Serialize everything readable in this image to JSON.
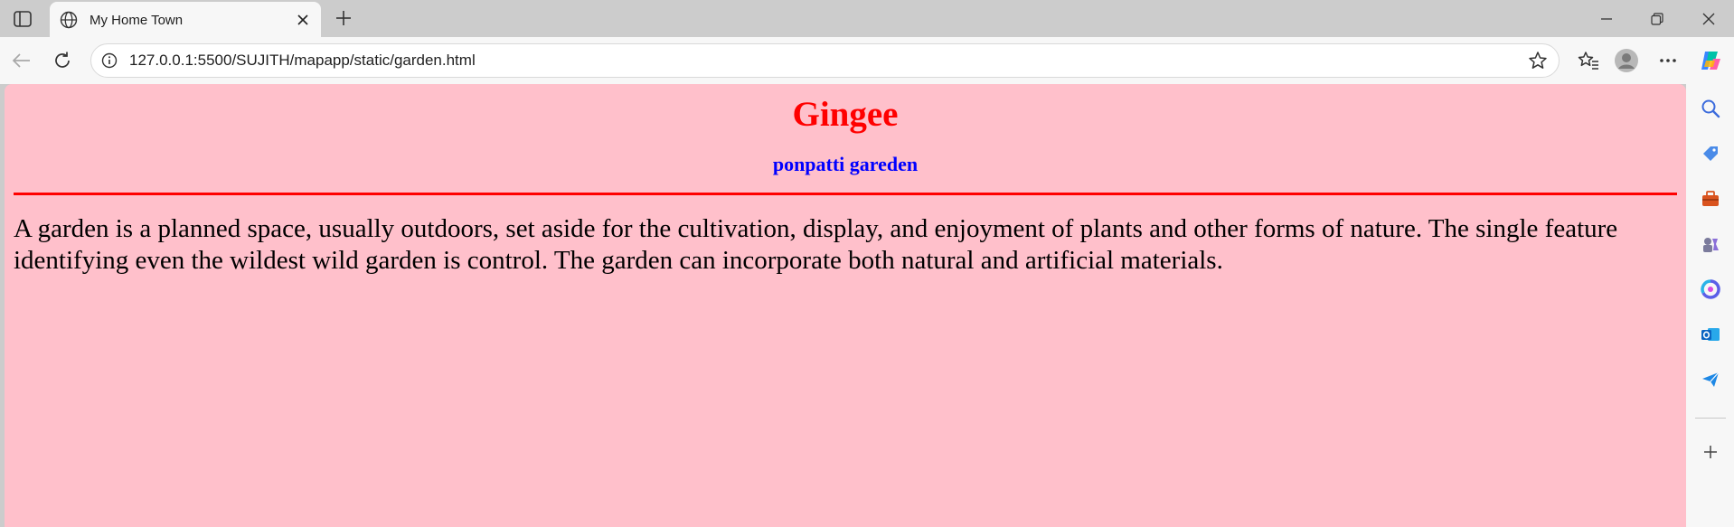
{
  "browser": {
    "tab": {
      "title": "My Home Town",
      "close_label": "×"
    },
    "new_tab_label": "+",
    "address": {
      "url": "127.0.0.1:5500/SUJITH/mapapp/static/garden.html"
    }
  },
  "page": {
    "heading": "Gingee",
    "subheading": "ponpatti gareden",
    "paragraph": "A garden is a planned space, usually outdoors, set aside for the cultivation, display, and enjoyment of plants and other forms of nature. The single feature identifying even the wildest wild garden is control. The garden can incorporate both natural and artificial materials."
  },
  "colors": {
    "page_background": "#ffc0cb",
    "heading": "#ff0000",
    "subheading": "#0000ff",
    "rule": "#ff0000"
  },
  "icons": {
    "tab_actions": "tab-actions-icon",
    "favicon": "globe-icon",
    "back": "back-arrow-icon",
    "reload": "reload-icon",
    "site_info": "info-icon",
    "favorite": "star-icon",
    "favorites": "favorites-icon",
    "profile": "profile-icon",
    "more": "more-icon",
    "copilot": "copilot-icon",
    "sidebar": [
      "search-icon",
      "tag-icon",
      "toolbox-icon",
      "games-icon",
      "microsoft365-icon",
      "outlook-icon",
      "send-icon",
      "add-icon"
    ]
  }
}
